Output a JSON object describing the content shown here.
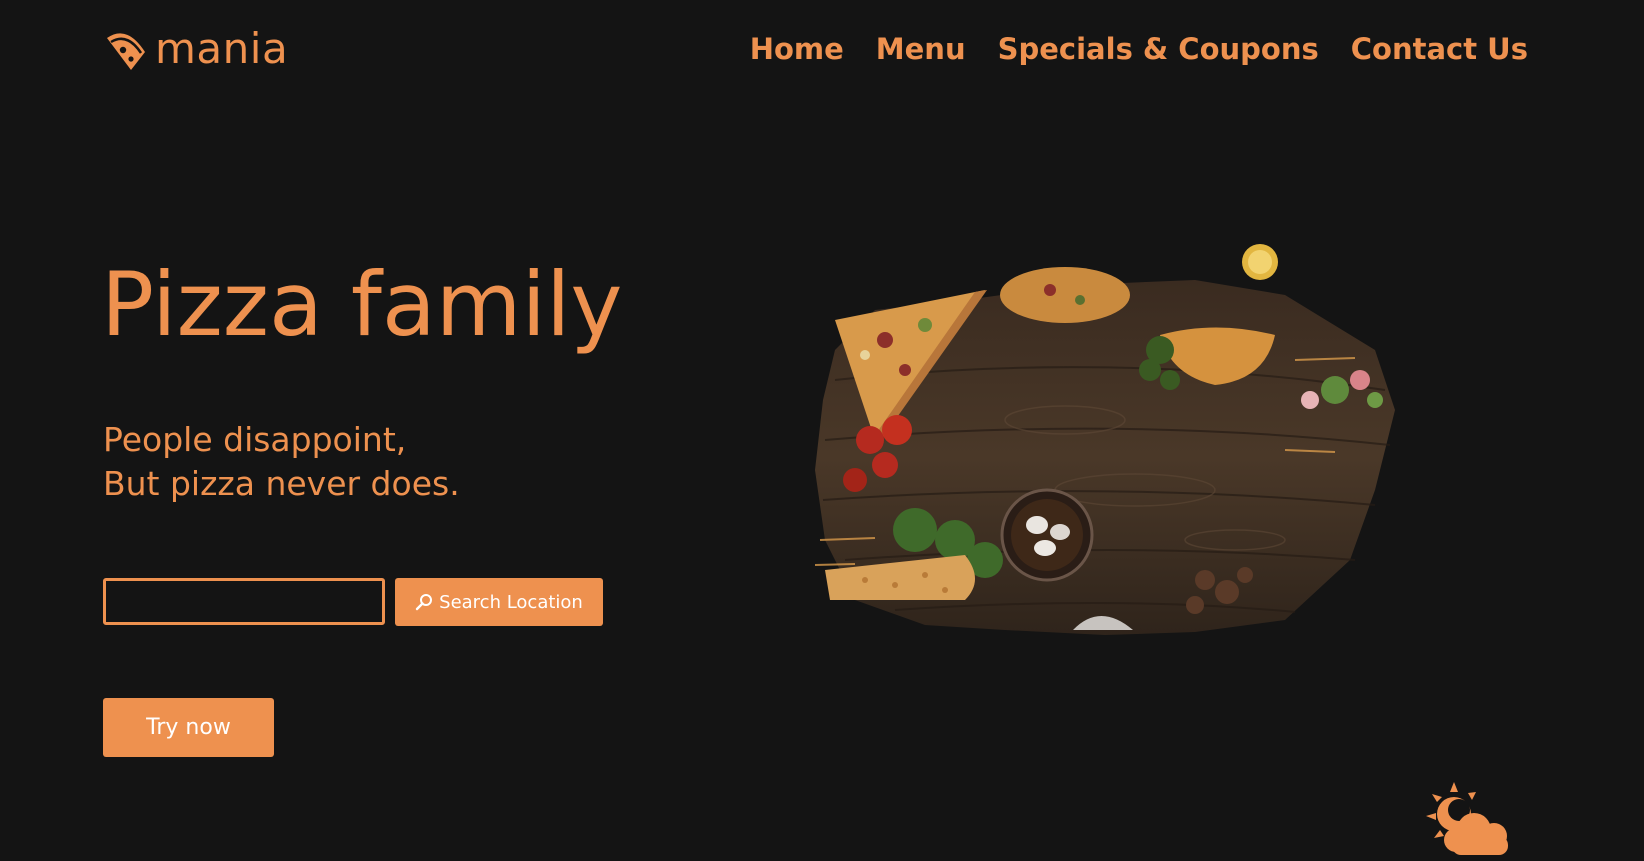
{
  "brand": {
    "name": "mania",
    "accent_color": "#ee914f",
    "background_color": "#141414",
    "logo_icon": "pizza-slice-icon"
  },
  "nav": {
    "items": [
      {
        "label": "Home"
      },
      {
        "label": "Menu"
      },
      {
        "label": "Specials & Coupons"
      },
      {
        "label": "Contact Us"
      }
    ]
  },
  "hero": {
    "title": "Pizza family",
    "tagline_line1": "People disappoint,",
    "tagline_line2": "But pizza never does.",
    "image": "pizza-table-spread-image"
  },
  "search": {
    "input_value": "",
    "button_label": "Search Location",
    "button_icon": "search-icon"
  },
  "cta": {
    "label": "Try now"
  },
  "weather": {
    "icon": "partly-cloudy-icon"
  }
}
